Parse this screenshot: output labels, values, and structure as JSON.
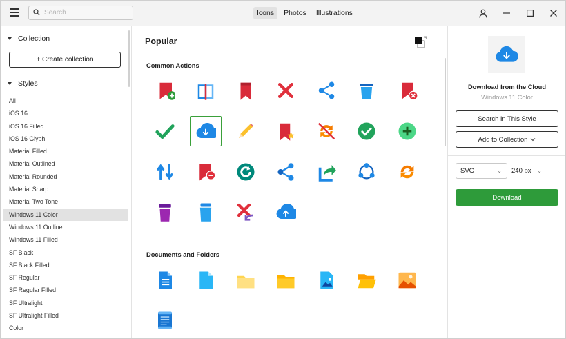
{
  "topbar": {
    "search": {
      "placeholder": "Search",
      "value": ""
    },
    "tabs": [
      {
        "label": "Icons",
        "active": true
      },
      {
        "label": "Photos",
        "active": false
      },
      {
        "label": "Illustrations",
        "active": false
      }
    ],
    "icons": [
      "menu-icon",
      "search-icon",
      "user-icon",
      "minimize-icon",
      "maximize-icon",
      "close-icon"
    ]
  },
  "sidebar": {
    "collection_header": "Collection",
    "create_label": "+ Create collection",
    "styles_header": "Styles",
    "styles": [
      "All",
      "iOS 16",
      "iOS 16 Filled",
      "iOS 16 Glyph",
      "Material Filled",
      "Material Outlined",
      "Material Rounded",
      "Material Sharp",
      "Material Two Tone",
      "Windows 11 Color",
      "Windows 11 Outline",
      "Windows 11 Filled",
      "SF Black",
      "SF Black Filled",
      "SF Regular",
      "SF Regular Filled",
      "SF Ultralight",
      "SF Ultralight Filled",
      "Color"
    ],
    "selected_style": "Windows 11 Color"
  },
  "main": {
    "title": "Popular",
    "categories": [
      {
        "title": "Common Actions",
        "icons": [
          "bookmark-add-icon",
          "open-book-icon",
          "bookmark-icon",
          "delete-x-icon",
          "share-icon",
          "trash-can-icon",
          "bookmark-remove-icon",
          "checkmark-icon",
          "cloud-download-icon",
          "pencil-icon",
          "bookmark-star-icon",
          "sync-off-icon",
          "check-circle-icon",
          "plus-circle-icon",
          "swap-arrows-icon",
          "bookmark-minus-icon",
          "refresh-circle-icon",
          "share-nodes-icon",
          "export-icon",
          "circular-nodes-icon",
          "sync-icon",
          "purple-bin-icon",
          "blue-bin-icon",
          "undo-x-icon",
          "cloud-upload-icon"
        ]
      },
      {
        "title": "Documents and Folders",
        "icons": [
          "document-icon",
          "file-icon",
          "folder-icon",
          "folder-filled-icon",
          "image-file-icon",
          "open-folder-icon",
          "picture-icon",
          "scroll-icon"
        ]
      }
    ],
    "selected_icon": "cloud-download-icon"
  },
  "panel": {
    "icon_name": "Download from the Cloud",
    "icon_style": "Windows 11 Color",
    "search_style_label": "Search in This Style",
    "add_collection_label": "Add to Collection",
    "format": "SVG",
    "size": "240 px",
    "download_label": "Download"
  },
  "colors": {
    "accent_green": "#2e9b3a",
    "selection_bg": "#e2e2e2",
    "cloud_blue": "#1e88e5",
    "bookmark_red": "#d92b3a"
  }
}
